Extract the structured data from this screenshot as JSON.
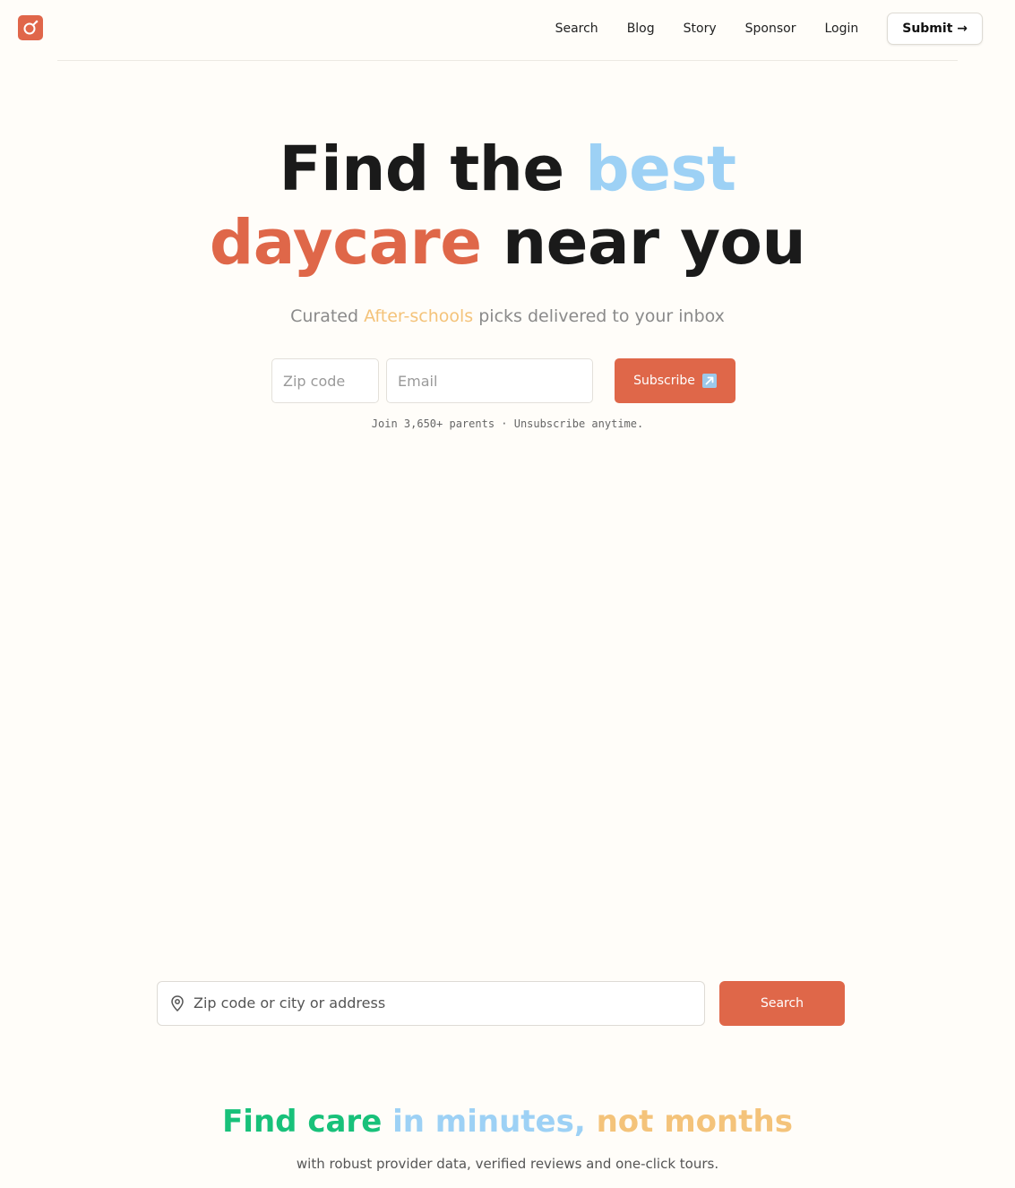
{
  "brand": {
    "logo_icon": "circle-arrow-logo-icon",
    "accent": "#df6749"
  },
  "nav": {
    "items": [
      {
        "label": "Search"
      },
      {
        "label": "Blog"
      },
      {
        "label": "Story"
      },
      {
        "label": "Sponsor"
      },
      {
        "label": "Login"
      }
    ],
    "submit_label": "Submit →"
  },
  "hero": {
    "line1_a": "Find the ",
    "line1_b": "best",
    "line2_a": "daycare",
    "line2_b": " near you",
    "subtitle_a": "Curated ",
    "subtitle_b": "After-schools",
    "subtitle_c": " picks delivered to your inbox"
  },
  "newsletter": {
    "zip_placeholder": "Zip code",
    "email_placeholder": "Email",
    "subscribe_label": "Subscribe",
    "subscribe_icon": "external-arrow-icon",
    "note": "Join 3,650+ parents · Unsubscribe anytime."
  },
  "search": {
    "placeholder": "Zip code or city or address",
    "button_label": "Search",
    "icon": "map-pin-icon"
  },
  "tagline": {
    "part1": "Find care",
    "part2": " in minutes,",
    "part3": " not months",
    "sub": "with robust provider data, verified reviews and one-click tours."
  },
  "colors": {
    "blue": "#9dd1f5",
    "coral": "#df6749",
    "yellow": "#f4c37a",
    "green": "#18c17a"
  }
}
